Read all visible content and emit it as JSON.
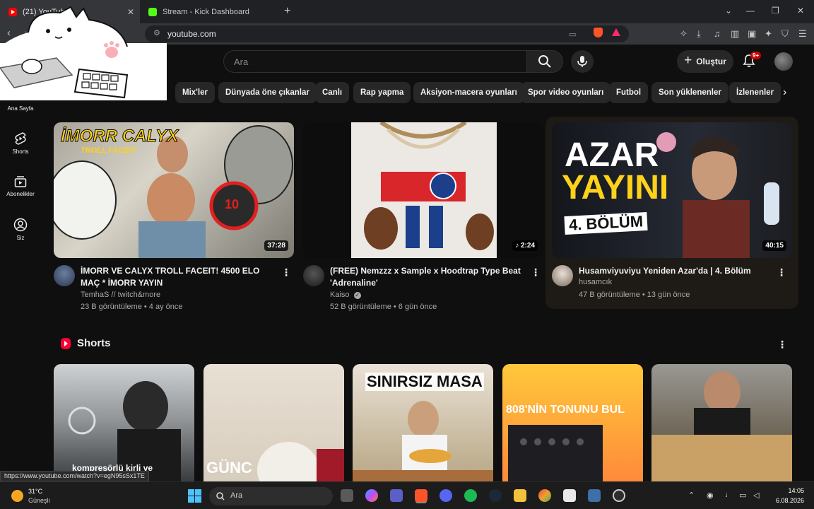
{
  "browser": {
    "tabs": [
      {
        "title": "(21) YouTube",
        "active": true
      },
      {
        "title": "Stream - Kick Dashboard",
        "active": false
      }
    ],
    "url": "youtube.com"
  },
  "header": {
    "search_placeholder": "Ara",
    "create_label": "Oluştur",
    "notif_count": "9+"
  },
  "chips": [
    "Mix'ler",
    "Dünyada öne çıkanlar",
    "Canlı",
    "Rap yapma",
    "Aksiyon-macera oyunları",
    "Spor video oyunları",
    "Futbol",
    "Son yüklenenler",
    "İzlenenler"
  ],
  "guide": [
    {
      "label": "Ana Sayfa",
      "icon": "home-icon"
    },
    {
      "label": "Shorts",
      "icon": "shorts-icon"
    },
    {
      "label": "Abonelikler",
      "icon": "subscriptions-icon"
    },
    {
      "label": "Siz",
      "icon": "you-icon"
    }
  ],
  "videos": [
    {
      "title": "İMORR VE CALYX TROLL FACEIT! 4500 ELO MAÇ * İMORR YAYIN",
      "channel": "TemhaS // twitch&more",
      "meta": "23 B görüntüleme • 4 ay önce",
      "duration": "37:28",
      "thumb_text": "İMORR CALYX",
      "thumb_sub": "TROLL FACEIT",
      "thumb_badge": "10"
    },
    {
      "title": "(FREE) Nemzzz x Sample x Hoodtrap Type Beat 'Adrenaline'",
      "channel": "Kaiso",
      "meta": "52 B görüntüleme • 6 gün önce",
      "duration": "2:24",
      "verified": true
    },
    {
      "title": "Husamviyuviyu Yeniden Azar'da | 4. Bölüm",
      "channel": "husamcık",
      "meta": "47 B görüntüleme • 13 gün önce",
      "duration": "40:15",
      "thumb_text": "AZAR",
      "thumb_text2": "YAYINI",
      "thumb_sub": "4. BÖLÜM"
    }
  ],
  "shorts": {
    "title": "Shorts",
    "items": [
      {
        "caption": "kompresörlü kirli ve"
      },
      {
        "caption": "GÜNC"
      },
      {
        "caption": "SINIRSIZ MASA"
      },
      {
        "caption": "808'NİN TONUNU BUL"
      },
      {
        "caption": ""
      }
    ]
  },
  "status_url": "https://www.youtube.com/watch?v=egN95sSx1TE",
  "taskbar": {
    "temp": "31°C",
    "weather": "Güneşli",
    "search_placeholder": "Ara",
    "time": "14:05",
    "date": "6.08.2026"
  },
  "colors": {
    "yt_red": "#ff0000",
    "background": "#0f0f0f",
    "chip": "#272727",
    "azar_yellow": "#ffd21a"
  }
}
